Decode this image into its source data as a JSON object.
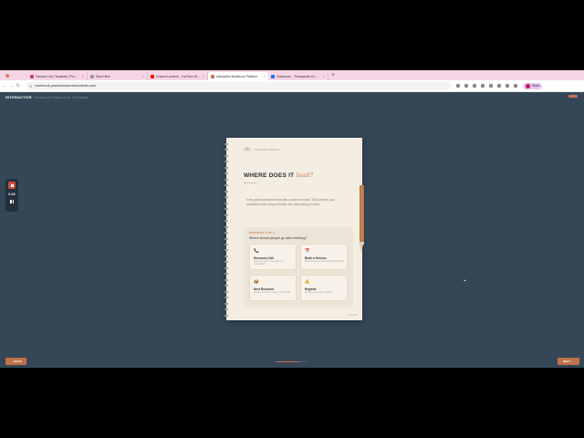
{
  "browser": {
    "tabs": [
      {
        "title": "General List | Template | Pro...",
        "color": "#d33b7a",
        "active": false
      },
      {
        "title": "Start Here",
        "color": "#999999",
        "active": false
      },
      {
        "title": "Channel content - YouTube Stu...",
        "color": "#ff0000",
        "active": false
      },
      {
        "title": "Interactive Workbook Platform",
        "color": "#c07a4e",
        "active": true
      },
      {
        "title": "Classroom - Therapeutic Ev...",
        "color": "#1a73e8",
        "active": false
      }
    ],
    "new_tab": "+",
    "url": "workbook.practicemanmetcontents.com",
    "profile_label": "Work"
  },
  "app": {
    "brand": "INTERACTIVE",
    "subtitle": "Workbook Platform for Therapists",
    "timer": "0:03",
    "back_label": "← BACK",
    "next_label": "NEXT →",
    "progress_fraction": 0.75
  },
  "page": {
    "number": "06",
    "kicker": "YOUR BLUEPRINT",
    "title_main": "WHERE DOES IT",
    "title_accent": "lead?",
    "body": "Every great workbook ends with a clear next step. This is where your workbook stops being a freebie and starts being a funnel.",
    "exercise_label": "EXERCISE 3 OF 3",
    "exercise_question": "Where should people go after finishing?",
    "options": [
      {
        "icon": "📞",
        "title": "Discovery Call",
        "desc": "Invite them into a free discovery conversation"
      },
      {
        "icon": "📅",
        "title": "Book a Session",
        "desc": "Direct scheduling of their first appointment"
      },
      {
        "icon": "📦",
        "title": "Next Resource",
        "desc": "Another workbook, course, or challenge"
      },
      {
        "icon": "✍",
        "title": "Register",
        "desc": "Join the next group or waitlist"
      }
    ],
    "footer": "06 / 06"
  }
}
